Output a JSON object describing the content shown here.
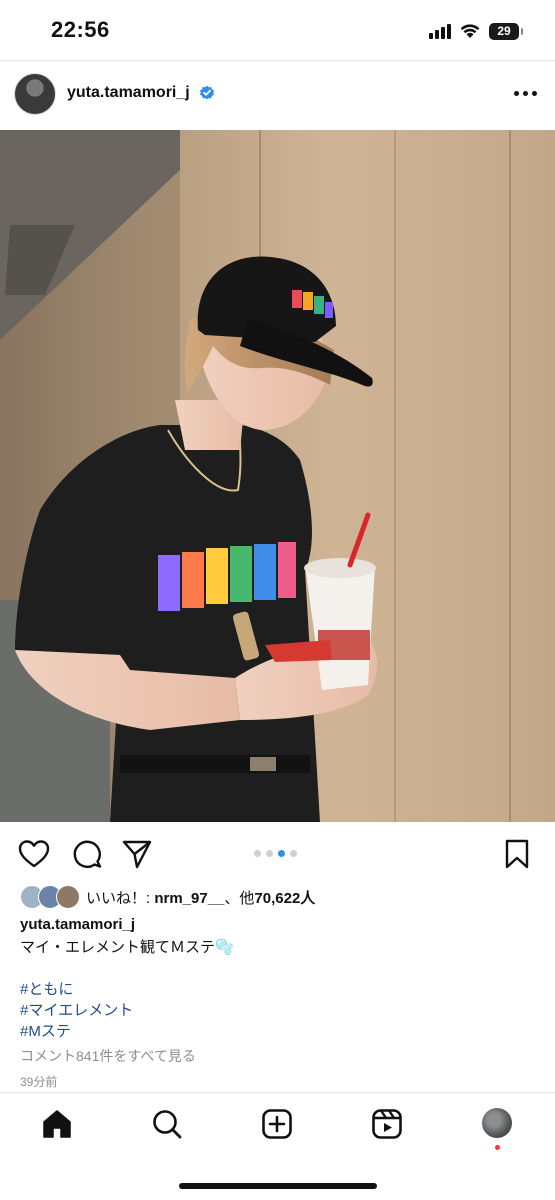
{
  "status_bar": {
    "time": "22:56",
    "battery": "29",
    "icons": [
      "cellular-signal-icon",
      "wifi-icon",
      "battery-icon"
    ]
  },
  "post": {
    "username": "yuta.tamamori_j",
    "verified_icon": "verified-badge-icon",
    "more_icon": "more-options-icon",
    "photo": "photo-man-in-black-tshirt-and-cap-holding-drink-cup",
    "carousel": {
      "total": 4,
      "active_index": 2
    },
    "likes_text_prefix": "いいね！: ",
    "likes_user": "nrm_97__",
    "likes_middle": "、他",
    "likes_count": "70,622人",
    "caption_user": "yuta.tamamori_j",
    "caption_text": "マイ・エレメント観てＭステ🫧",
    "hashtags": [
      "#ともに",
      "#マイエレメント",
      "#Mステ"
    ],
    "comments_link": "コメント841件をすべて見る",
    "time_ago": "39分前"
  },
  "actions": {
    "like_icon": "heart-icon",
    "comment_icon": "comment-icon",
    "share_icon": "send-icon",
    "save_icon": "bookmark-icon"
  },
  "tab_bar": {
    "items": [
      "home-icon",
      "search-icon",
      "create-post-icon",
      "reels-icon",
      "profile-avatar"
    ],
    "notification_color": "#ff3040"
  },
  "colors": {
    "link": "#1f4d8b",
    "carousel_active": "#2b8ef0",
    "muted_text": "#8e8e8e"
  }
}
